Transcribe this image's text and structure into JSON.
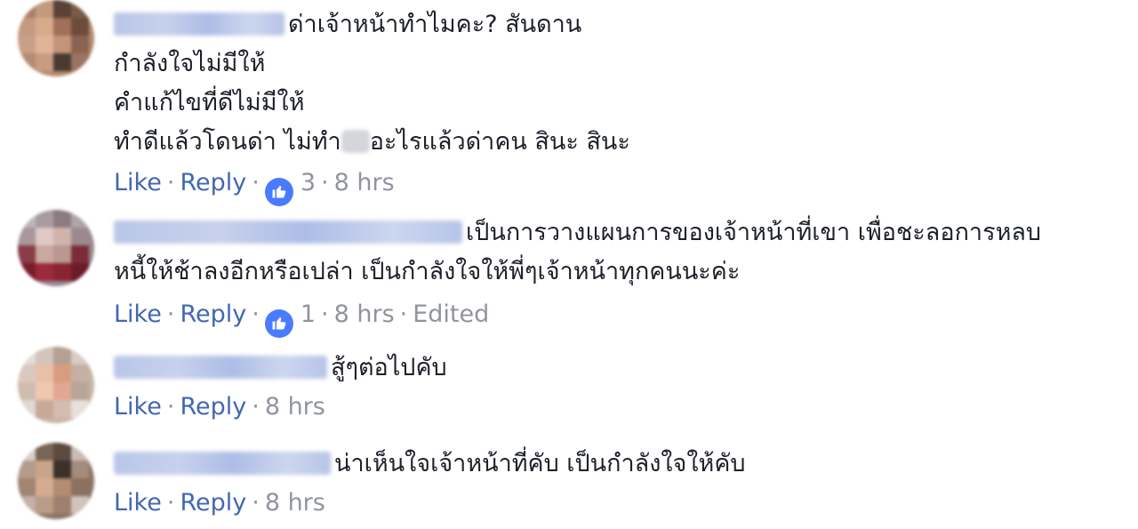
{
  "comments": [
    {
      "text_lines": [
        "ด่าเจ้าหน้าทำไมคะ? สันดาน",
        "กำลังใจไม่มีให้",
        "คำแก้ไขที่ดีไม่มีให้",
        "ทำดีแล้วโดนด่า ไม่ทำ",
        "อะไรแล้วด่าคน สินะ สินะ"
      ],
      "like_label": "Like",
      "reply_label": "Reply",
      "reaction_count": "3",
      "time": "8 hrs"
    },
    {
      "text_lines": [
        "เป็นการวางแผนการของเจ้าหน้าที่เขา เพื่อชะลอการหลบ",
        "หนี้ให้ช้าลงอีกหรือเปล่า เป็นกำลังใจให้พี่ๆเจ้าหน้าทุกคนนะค่ะ"
      ],
      "like_label": "Like",
      "reply_label": "Reply",
      "reaction_count": "1",
      "time": "8 hrs",
      "edited": "Edited"
    },
    {
      "text_lines": [
        "สู้ๆต่อไปคับ"
      ],
      "like_label": "Like",
      "reply_label": "Reply",
      "time": "8 hrs"
    },
    {
      "text_lines": [
        "น่าเห็นใจเจ้าหน้าที่คับ เป็นกำลังใจให้คับ"
      ],
      "like_label": "Like",
      "reply_label": "Reply",
      "time": "8 hrs"
    }
  ],
  "colors": {
    "link": "#4267b2",
    "meta": "#90949c",
    "text": "#1d2129",
    "like_badge": "#4a7bff"
  },
  "icons": {
    "reaction": "thumbs-up-icon"
  }
}
